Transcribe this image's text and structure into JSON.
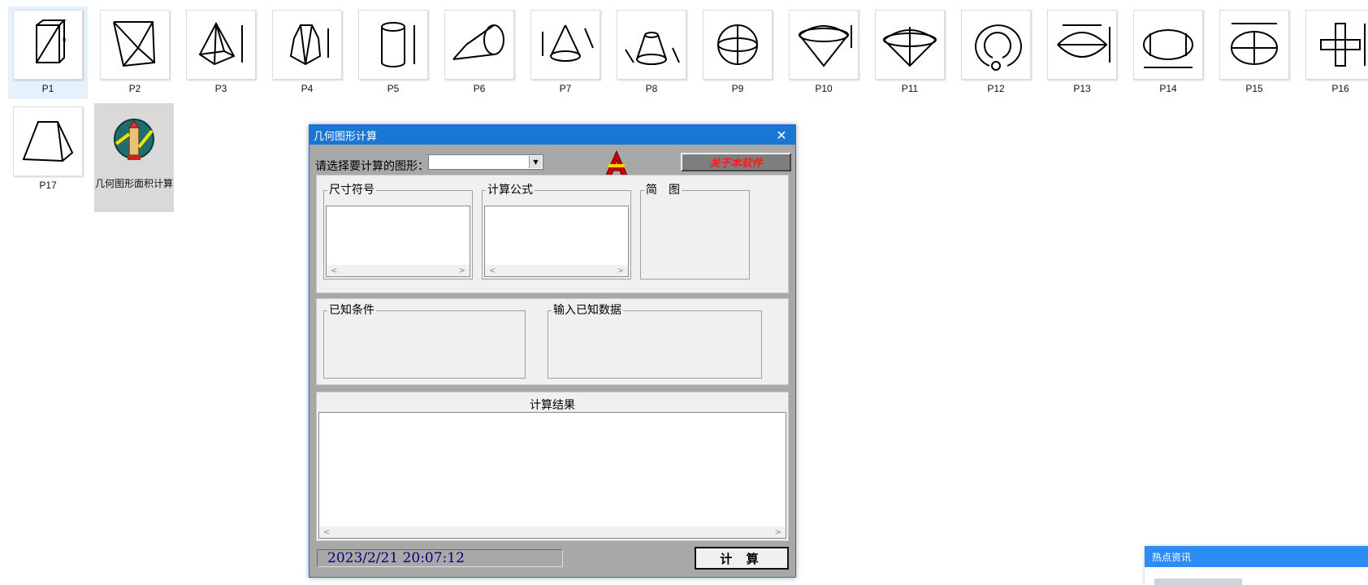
{
  "desktop": {
    "files": [
      "P1",
      "P2",
      "P3",
      "P4",
      "P5",
      "P6",
      "P7",
      "P8",
      "P9",
      "P10",
      "P11",
      "P12",
      "P13",
      "P14",
      "P15",
      "P16",
      "P17"
    ],
    "app_label": "几何图形面积计算"
  },
  "dialog": {
    "title": "几何图形计算",
    "close_glyph": "✕",
    "select_label": "请选择要计算的图形：",
    "select_value": "",
    "combo_arrow": "▼",
    "about_button": "关于本软件",
    "groups": {
      "dimension": "尺寸符号",
      "formula": "计算公式",
      "diagram": "简　图",
      "known": "已知条件",
      "input": "输入已知数据"
    },
    "scroll_left": "<",
    "scroll_right": ">",
    "result_title": "计算结果",
    "datetime": "2023/2/21  20:07:12",
    "calc_button": "计 算"
  },
  "news": {
    "title": "热点资讯"
  },
  "colors": {
    "titlebar": "#1976d2",
    "dialog_bg": "#a8a8a8",
    "about_text": "#ff1a1a",
    "datetime_text": "#000080",
    "news_header": "#2d8df5"
  }
}
